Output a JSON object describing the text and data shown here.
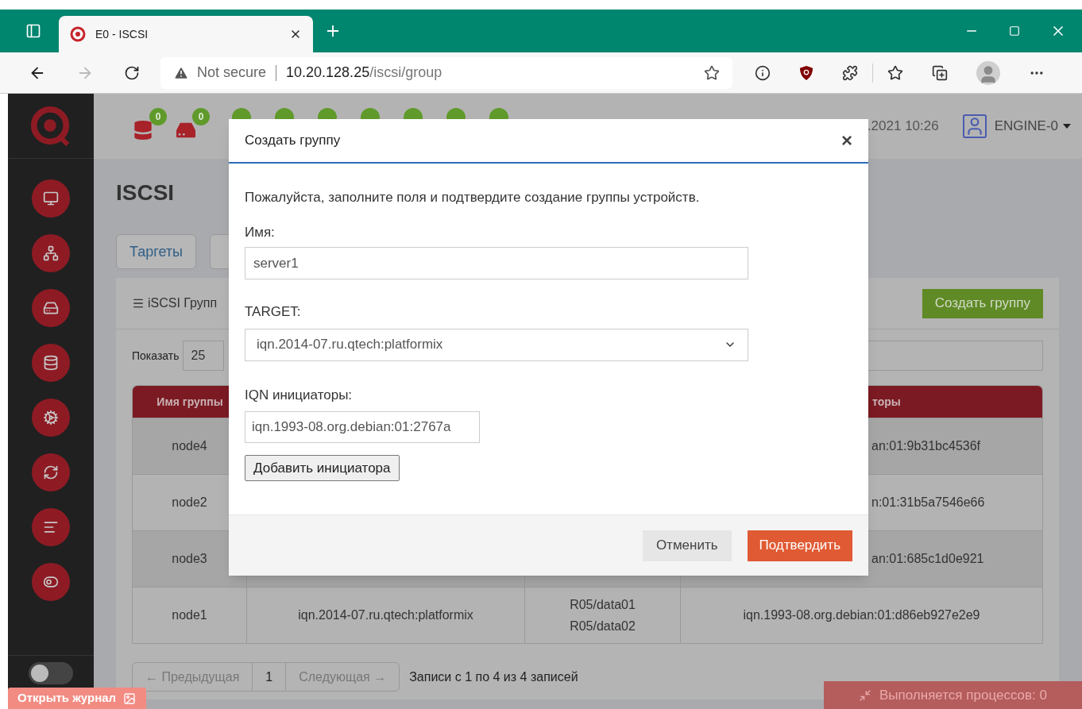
{
  "browser": {
    "tab": {
      "title": "E0 - ISCSI"
    },
    "address": {
      "security": "Not secure",
      "host": "10.20.128.25",
      "path": "/iscsi/group"
    }
  },
  "sidebar": {
    "toggle": {
      "on": false
    }
  },
  "header": {
    "badges": [
      "0",
      "0"
    ],
    "datetime": ".2021 10:26",
    "user": "ENGINE-0"
  },
  "page": {
    "title": "ISCSI",
    "tabs": [
      "Таргеты"
    ]
  },
  "panel": {
    "title": "iSCSI Групп",
    "create_button": "Создать группу",
    "show_label": "Показать",
    "page_size": "25"
  },
  "table": {
    "columns": {
      "group": "Имя группы",
      "column_4": "торы"
    },
    "rows": [
      {
        "kind": "partly-hidden",
        "group": "node4",
        "column_4": "an:01:9b31bc4536f"
      },
      {
        "kind": "partly-hidden",
        "group": "node2",
        "column_4": "n:01:31b5a7546e66"
      },
      {
        "kind": "partly-hidden",
        "group": "node3",
        "column_4": "an:01:685c1d0e921"
      },
      {
        "kind": "whole",
        "group": "node1",
        "column_2": "iqn.2014-07.ru.qtech:platformix",
        "column_3": [
          "R05/data01",
          "R05/data02"
        ],
        "column_4": "iqn.1993-08.org.debian:01:d86eb927e2e9"
      }
    ]
  },
  "pagination": {
    "prev": "← Предыдущая",
    "page": "1",
    "next": "Следующая →",
    "info": "Записи с 1 по 4 из 4 записей"
  },
  "modal": {
    "title": "Создать группу",
    "close": "×",
    "intro": "Пожалуйста, заполните поля и подтвердите создание группы устройств.",
    "name_label": "Имя:",
    "name_value": "server1",
    "target_label": "TARGET:",
    "target_value": "iqn.2014-07.ru.qtech:platformix",
    "iqn_label": "IQN инициаторы:",
    "iqn_value": "iqn.1993-08.org.debian:01:2767a",
    "add_button": "Добавить инициатора",
    "cancel_button": "Отменить",
    "confirm_button": "Подтвердить"
  },
  "footer": {
    "log_button": "Открыть журнал",
    "processes": "Выполняется процессов: 0"
  }
}
